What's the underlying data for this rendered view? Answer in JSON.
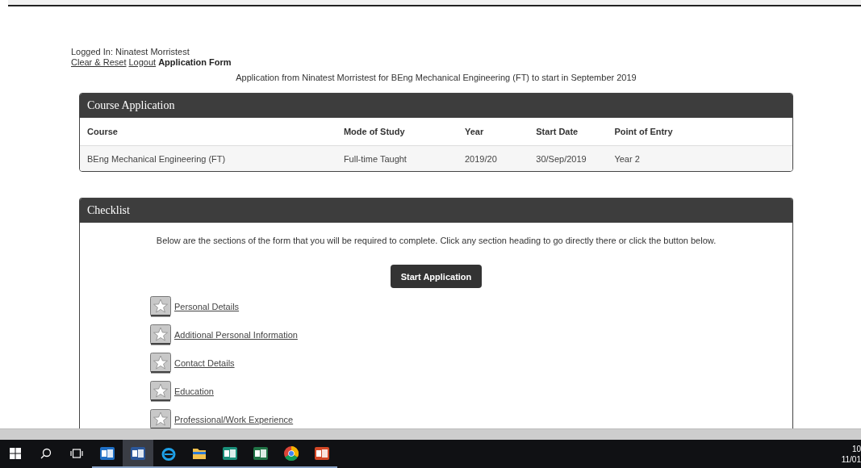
{
  "session": {
    "logged_in": "Logged In: Ninatest Morristest",
    "links": [
      "Clear & Reset",
      "Logout"
    ],
    "page_title": "Application Form",
    "subtitle": "Application from Ninatest Morristest for BEng Mechanical Engineering (FT) to start in September 2019"
  },
  "course_application": {
    "title": "Course Application",
    "columns": [
      "Course",
      "Mode of Study",
      "Year",
      "Start Date",
      "Point of Entry"
    ],
    "rows": [
      [
        "BEng Mechanical Engineering (FT)",
        "Full-time Taught",
        "2019/20",
        "30/Sep/2019",
        "Year 2"
      ]
    ]
  },
  "checklist": {
    "title": "Checklist",
    "intro": "Below are the sections of the form that you will be required to complete. Click any section heading to go directly there or click the button below.",
    "button": "Start Application",
    "sections": [
      {
        "label": "Personal Details",
        "completed": false
      },
      {
        "label": "Additional Personal Information",
        "completed": false
      },
      {
        "label": "Contact Details",
        "completed": false
      },
      {
        "label": "Education",
        "completed": false
      },
      {
        "label": "Professional/Work Experience",
        "completed": false
      }
    ]
  },
  "taskbar": {
    "apps": [
      {
        "kind": "outlook",
        "running": true,
        "selected": false
      },
      {
        "kind": "word",
        "running": true,
        "selected": true
      },
      {
        "kind": "ie",
        "running": true,
        "selected": false
      },
      {
        "kind": "explorer",
        "running": true,
        "selected": false
      },
      {
        "kind": "sway",
        "running": true,
        "selected": false
      },
      {
        "kind": "excel",
        "running": true,
        "selected": false
      },
      {
        "kind": "chrome",
        "running": true,
        "selected": false
      },
      {
        "kind": "powerpoint",
        "running": true,
        "selected": false
      }
    ],
    "clock": [
      "10",
      "11/01"
    ]
  }
}
